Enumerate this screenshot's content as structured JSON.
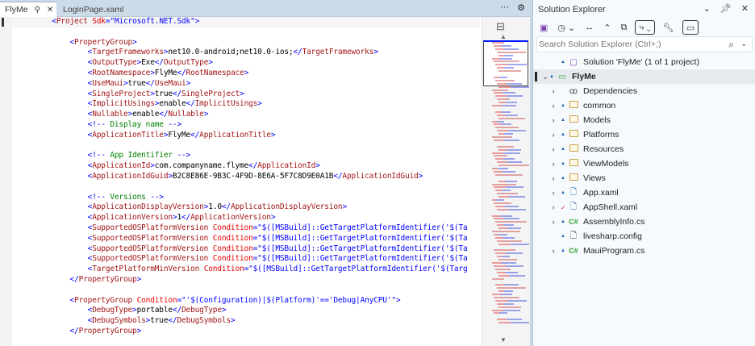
{
  "editor": {
    "tabs": [
      {
        "label": "FlyMe",
        "active": true
      },
      {
        "label": "LoginPage.xaml",
        "active": false
      }
    ],
    "tab_icons": [
      "pin-icon",
      "close-icon"
    ],
    "more_label": "···",
    "lines": [
      {
        "i": 8,
        "t": [
          [
            "p",
            "<"
          ],
          [
            "n",
            "Project"
          ],
          [
            "x",
            " "
          ],
          [
            "a",
            "Sdk"
          ],
          [
            "p",
            "=\""
          ],
          [
            "v",
            "Microsoft.NET.Sdk"
          ],
          [
            "p",
            "\">"
          ]
        ]
      },
      {
        "i": 0,
        "t": []
      },
      {
        "i": 12,
        "t": [
          [
            "p",
            "<"
          ],
          [
            "n",
            "PropertyGroup"
          ],
          [
            "p",
            ">"
          ]
        ]
      },
      {
        "i": 16,
        "t": [
          [
            "p",
            "<"
          ],
          [
            "n",
            "TargetFrameworks"
          ],
          [
            "p",
            ">"
          ],
          [
            "x",
            "net10.0-android;net10.0-ios;"
          ],
          [
            "p",
            "</"
          ],
          [
            "n",
            "TargetFrameworks"
          ],
          [
            "p",
            ">"
          ]
        ]
      },
      {
        "i": 16,
        "t": [
          [
            "p",
            "<"
          ],
          [
            "n",
            "OutputType"
          ],
          [
            "p",
            ">"
          ],
          [
            "x",
            "Exe"
          ],
          [
            "p",
            "</"
          ],
          [
            "n",
            "OutputType"
          ],
          [
            "p",
            ">"
          ]
        ]
      },
      {
        "i": 16,
        "t": [
          [
            "p",
            "<"
          ],
          [
            "n",
            "RootNamespace"
          ],
          [
            "p",
            ">"
          ],
          [
            "x",
            "FlyMe"
          ],
          [
            "p",
            "</"
          ],
          [
            "n",
            "RootNamespace"
          ],
          [
            "p",
            ">"
          ]
        ]
      },
      {
        "i": 16,
        "t": [
          [
            "p",
            "<"
          ],
          [
            "n",
            "UseMaui"
          ],
          [
            "p",
            ">"
          ],
          [
            "x",
            "true"
          ],
          [
            "p",
            "</"
          ],
          [
            "n",
            "UseMaui"
          ],
          [
            "p",
            ">"
          ]
        ]
      },
      {
        "i": 16,
        "t": [
          [
            "p",
            "<"
          ],
          [
            "n",
            "SingleProject"
          ],
          [
            "p",
            ">"
          ],
          [
            "x",
            "true"
          ],
          [
            "p",
            "</"
          ],
          [
            "n",
            "SingleProject"
          ],
          [
            "p",
            ">"
          ]
        ]
      },
      {
        "i": 16,
        "t": [
          [
            "p",
            "<"
          ],
          [
            "n",
            "ImplicitUsings"
          ],
          [
            "p",
            ">"
          ],
          [
            "x",
            "enable"
          ],
          [
            "p",
            "</"
          ],
          [
            "n",
            "ImplicitUsings"
          ],
          [
            "p",
            ">"
          ]
        ]
      },
      {
        "i": 16,
        "t": [
          [
            "p",
            "<"
          ],
          [
            "n",
            "Nullable"
          ],
          [
            "p",
            ">"
          ],
          [
            "x",
            "enable"
          ],
          [
            "p",
            "</"
          ],
          [
            "n",
            "Nullable"
          ],
          [
            "p",
            ">"
          ]
        ]
      },
      {
        "i": 16,
        "t": [
          [
            "p",
            "<!--"
          ],
          [
            "c",
            " Display name "
          ],
          [
            "p",
            "-->"
          ]
        ]
      },
      {
        "i": 16,
        "t": [
          [
            "p",
            "<"
          ],
          [
            "n",
            "ApplicationTitle"
          ],
          [
            "p",
            ">"
          ],
          [
            "x",
            "FlyMe"
          ],
          [
            "p",
            "</"
          ],
          [
            "n",
            "ApplicationTitle"
          ],
          [
            "p",
            ">"
          ]
        ]
      },
      {
        "i": 0,
        "t": []
      },
      {
        "i": 16,
        "t": [
          [
            "p",
            "<!--"
          ],
          [
            "c",
            " App Identifier "
          ],
          [
            "p",
            "-->"
          ]
        ]
      },
      {
        "i": 16,
        "t": [
          [
            "p",
            "<"
          ],
          [
            "n",
            "ApplicationId"
          ],
          [
            "p",
            ">"
          ],
          [
            "x",
            "com.companyname.flyme"
          ],
          [
            "p",
            "</"
          ],
          [
            "n",
            "ApplicationId"
          ],
          [
            "p",
            ">"
          ]
        ]
      },
      {
        "i": 16,
        "t": [
          [
            "p",
            "<"
          ],
          [
            "n",
            "ApplicationIdGuid"
          ],
          [
            "p",
            ">"
          ],
          [
            "x",
            "B2C8E86E-9B3C-4F9D-8E6A-5F7C8D9E0A1B"
          ],
          [
            "p",
            "</"
          ],
          [
            "n",
            "ApplicationIdGuid"
          ],
          [
            "p",
            ">"
          ]
        ]
      },
      {
        "i": 0,
        "t": []
      },
      {
        "i": 16,
        "t": [
          [
            "p",
            "<!--"
          ],
          [
            "c",
            " Versions "
          ],
          [
            "p",
            "-->"
          ]
        ]
      },
      {
        "i": 16,
        "t": [
          [
            "p",
            "<"
          ],
          [
            "n",
            "ApplicationDisplayVersion"
          ],
          [
            "p",
            ">"
          ],
          [
            "x",
            "1.0"
          ],
          [
            "p",
            "</"
          ],
          [
            "n",
            "ApplicationDisplayVersion"
          ],
          [
            "p",
            ">"
          ]
        ]
      },
      {
        "i": 16,
        "t": [
          [
            "p",
            "<"
          ],
          [
            "n",
            "ApplicationVersion"
          ],
          [
            "p",
            ">"
          ],
          [
            "x",
            "1"
          ],
          [
            "p",
            "</"
          ],
          [
            "n",
            "ApplicationVersion"
          ],
          [
            "p",
            ">"
          ]
        ]
      },
      {
        "i": 16,
        "t": [
          [
            "p",
            "<"
          ],
          [
            "n",
            "SupportedOSPlatformVersion"
          ],
          [
            "x",
            " "
          ],
          [
            "a",
            "Condition"
          ],
          [
            "p",
            "=\""
          ],
          [
            "v",
            "$([MSBuild]::GetTargetPlatformIdentifier('$(Ta"
          ]
        ]
      },
      {
        "i": 16,
        "t": [
          [
            "p",
            "<"
          ],
          [
            "n",
            "SupportedOSPlatformVersion"
          ],
          [
            "x",
            " "
          ],
          [
            "a",
            "Condition"
          ],
          [
            "p",
            "=\""
          ],
          [
            "v",
            "$([MSBuild]::GetTargetPlatformIdentifier('$(Ta"
          ]
        ]
      },
      {
        "i": 16,
        "t": [
          [
            "p",
            "<"
          ],
          [
            "n",
            "SupportedOSPlatformVersion"
          ],
          [
            "x",
            " "
          ],
          [
            "a",
            "Condition"
          ],
          [
            "p",
            "=\""
          ],
          [
            "v",
            "$([MSBuild]::GetTargetPlatformIdentifier('$(Ta"
          ]
        ]
      },
      {
        "i": 16,
        "t": [
          [
            "p",
            "<"
          ],
          [
            "n",
            "SupportedOSPlatformVersion"
          ],
          [
            "x",
            " "
          ],
          [
            "a",
            "Condition"
          ],
          [
            "p",
            "=\""
          ],
          [
            "v",
            "$([MSBuild]::GetTargetPlatformIdentifier('$(Ta"
          ]
        ]
      },
      {
        "i": 16,
        "t": [
          [
            "p",
            "<"
          ],
          [
            "n",
            "TargetPlatformMinVersion"
          ],
          [
            "x",
            " "
          ],
          [
            "a",
            "Condition"
          ],
          [
            "p",
            "=\""
          ],
          [
            "v",
            "$([MSBuild]::GetTargetPlatformIdentifier('$(Targ"
          ]
        ]
      },
      {
        "i": 12,
        "t": [
          [
            "p",
            "</"
          ],
          [
            "n",
            "PropertyGroup"
          ],
          [
            "p",
            ">"
          ]
        ]
      },
      {
        "i": 0,
        "t": []
      },
      {
        "i": 12,
        "t": [
          [
            "p",
            "<"
          ],
          [
            "n",
            "PropertyGroup"
          ],
          [
            "x",
            " "
          ],
          [
            "a",
            "Condition"
          ],
          [
            "p",
            "=\""
          ],
          [
            "v",
            "'$(Configuration)|$(Platform)'=='Debug|AnyCPU'"
          ],
          [
            "p",
            "\">"
          ]
        ]
      },
      {
        "i": 16,
        "t": [
          [
            "p",
            "<"
          ],
          [
            "n",
            "DebugType"
          ],
          [
            "p",
            ">"
          ],
          [
            "x",
            "portable"
          ],
          [
            "p",
            "</"
          ],
          [
            "n",
            "DebugType"
          ],
          [
            "p",
            ">"
          ]
        ]
      },
      {
        "i": 16,
        "t": [
          [
            "p",
            "<"
          ],
          [
            "n",
            "DebugSymbols"
          ],
          [
            "p",
            ">"
          ],
          [
            "x",
            "true"
          ],
          [
            "p",
            "</"
          ],
          [
            "n",
            "DebugSymbols"
          ],
          [
            "p",
            ">"
          ]
        ]
      },
      {
        "i": 12,
        "t": [
          [
            "p",
            "</"
          ],
          [
            "n",
            "PropertyGroup"
          ],
          [
            "p",
            ">"
          ]
        ]
      }
    ]
  },
  "solution_explorer": {
    "title": "Solution Explorer",
    "search_placeholder": "Search Solution Explorer (Ctrl+;)",
    "items": [
      {
        "label": "Solution 'FlyMe' (1 of 1 project)",
        "level": 0,
        "icon": "solution-icon",
        "expander": false,
        "lock": true
      },
      {
        "label": "FlyMe",
        "level": 0,
        "icon": "csproj-icon",
        "expander": "open",
        "lock": true,
        "selected": true,
        "bold": true
      },
      {
        "label": "Dependencies",
        "level": 1,
        "icon": "dependencies-icon",
        "expander": "closed",
        "lock": false
      },
      {
        "label": "common",
        "level": 1,
        "icon": "folder-icon",
        "expander": "closed",
        "lock": true
      },
      {
        "label": "Models",
        "level": 1,
        "icon": "folder-icon",
        "expander": "closed",
        "lock": true
      },
      {
        "label": "Platforms",
        "level": 1,
        "icon": "folder-icon",
        "expander": "closed",
        "lock": true
      },
      {
        "label": "Resources",
        "level": 1,
        "icon": "folder-icon",
        "expander": "closed",
        "lock": true
      },
      {
        "label": "ViewModels",
        "level": 1,
        "icon": "folder-icon",
        "expander": "closed",
        "lock": true
      },
      {
        "label": "Views",
        "level": 1,
        "icon": "folder-icon",
        "expander": "closed",
        "lock": true
      },
      {
        "label": "App.xaml",
        "level": 1,
        "icon": "xaml-file-icon",
        "expander": "closed",
        "lock": true
      },
      {
        "label": "AppShell.xaml",
        "level": 1,
        "icon": "xaml-file-icon",
        "expander": "closed",
        "lock": false,
        "checked": true
      },
      {
        "label": "AssemblyInfo.cs",
        "level": 1,
        "icon": "csharp-file-icon",
        "expander": "closed",
        "lock": true
      },
      {
        "label": "livesharp.config",
        "level": 1,
        "icon": "config-file-icon",
        "expander": false,
        "lock": true
      },
      {
        "label": "MauiProgram.cs",
        "level": 1,
        "icon": "csharp-file-icon",
        "expander": "closed",
        "lock": true
      }
    ]
  }
}
